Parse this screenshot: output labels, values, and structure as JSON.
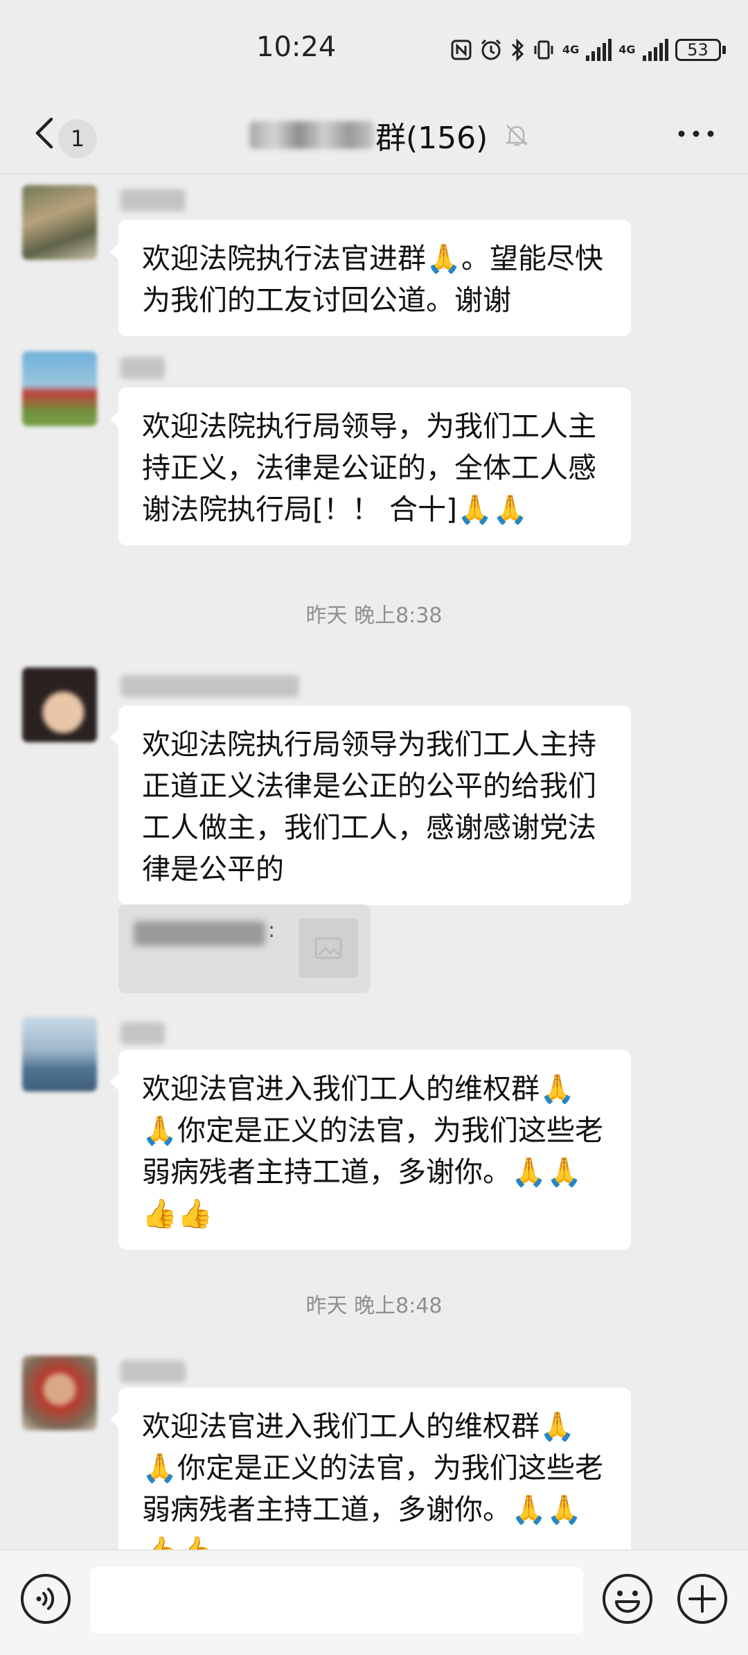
{
  "status_bar": {
    "time": "10:24",
    "network_1": "4G",
    "network_2": "4G",
    "battery": "53"
  },
  "header": {
    "back_count": "1",
    "title_suffix": "群(156)"
  },
  "messages": [
    {
      "text": "欢迎法院执行法官进群🙏。望能尽快为我们的工友讨回公道。谢谢"
    },
    {
      "text": "欢迎法院执行局领导，为我们工人主持正义，法律是公证的，全体工人感谢法院执行局[！！ 合十]🙏🙏"
    },
    {
      "text": " 欢迎法院执行局领导为我们工人主持正道正义法律是公正的公平的给我们工人做主，我们工人，感谢感谢党法律是公平的"
    },
    {
      "text": "欢迎法官进入我们工人的维权群🙏🙏你定是正义的法官，为我们这些老弱病残者主持工道，多谢你。🙏🙏👍👍"
    },
    {
      "text": "欢迎法官进入我们工人的维权群🙏🙏你定是正义的法官，为我们这些老弱病残者主持工道，多谢你。🙏🙏👍👍"
    }
  ],
  "timestamps": [
    "昨天 晚上8:38",
    "昨天 晚上8:48"
  ],
  "quote": {
    "colon": ":"
  },
  "colors": {
    "background": "#ededed",
    "bubble": "#ffffff",
    "timestamp": "#8f8f8f"
  },
  "icons": [
    "back-chevron-icon",
    "mute-bell-icon",
    "more-icon",
    "voice-icon",
    "emoji-icon",
    "add-icon",
    "image-icon"
  ]
}
